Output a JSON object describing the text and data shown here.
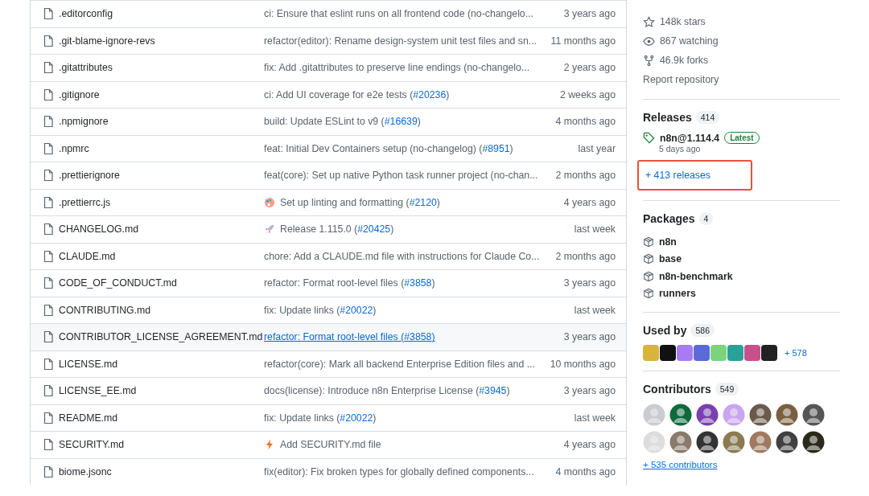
{
  "files": [
    {
      "name": ".editorconfig",
      "message": "ci: Ensure that eslint runs on all frontend code (no-changelo...",
      "time": "3 years ago",
      "hovered": false
    },
    {
      "name": ".git-blame-ignore-revs",
      "message": "refactor(editor): Rename design-system unit test files and sn...",
      "time": "11 months ago",
      "hovered": false
    },
    {
      "name": ".gitattributes",
      "message": "fix: Add .gitattributes to preserve line endings (no-changelo...",
      "time": "2 years ago",
      "hovered": false
    },
    {
      "name": ".gitignore",
      "message": "ci: Add UI coverage for e2e tests (",
      "pr": "#20236",
      "after": ")",
      "time": "2 weeks ago",
      "hovered": false
    },
    {
      "name": ".npmignore",
      "message": "build: Update ESLint to v9 (",
      "pr": "#16639",
      "after": ")",
      "time": "4 months ago",
      "hovered": false
    },
    {
      "name": ".npmrc",
      "message": "feat: Initial Dev Containers setup (no-changelog) (",
      "pr": "#8951",
      "after": ")",
      "time": "last year",
      "hovered": false
    },
    {
      "name": ".prettierignore",
      "message": "feat(core): Set up native Python task runner project (no-chan...",
      "time": "2 months ago",
      "hovered": false
    },
    {
      "name": ".prettierrc.js",
      "kind": "palette",
      "message": "Set up linting and formatting (",
      "pr": "#2120",
      "after": ")",
      "time": "4 years ago",
      "hovered": false
    },
    {
      "name": "CHANGELOG.md",
      "kind": "rocket",
      "message": "Release 1.115.0 (",
      "pr": "#20425",
      "after": ")",
      "time": "last week",
      "hovered": false
    },
    {
      "name": "CLAUDE.md",
      "message": "chore: Add a CLAUDE.md file with instructions for Claude Co...",
      "time": "2 months ago",
      "hovered": false
    },
    {
      "name": "CODE_OF_CONDUCT.md",
      "message": "refactor: Format root-level files (",
      "pr": "#3858",
      "after": ")",
      "time": "3 years ago",
      "hovered": false
    },
    {
      "name": "CONTRIBUTING.md",
      "message": "fix: Update links (",
      "pr": "#20022",
      "after": ")",
      "time": "last week",
      "hovered": false
    },
    {
      "name": "CONTRIBUTOR_LICENSE_AGREEMENT.md",
      "message": "refactor: Format root-level files (",
      "pr": "#3858",
      "after": ")",
      "time": "3 years ago",
      "hovered": true
    },
    {
      "name": "LICENSE.md",
      "message": "refactor(core): Mark all backend Enterprise Edition files and ...",
      "time": "10 months ago",
      "hovered": false
    },
    {
      "name": "LICENSE_EE.md",
      "message": "docs(license): Introduce n8n Enterprise License (",
      "pr": "#3945",
      "after": ")",
      "time": "3 years ago",
      "hovered": false
    },
    {
      "name": "README.md",
      "message": "fix: Update links (",
      "pr": "#20022",
      "after": ")",
      "time": "last week",
      "hovered": false
    },
    {
      "name": "SECURITY.md",
      "kind": "zap",
      "message": "Add SECURITY.md file",
      "time": "4 years ago",
      "hovered": false
    },
    {
      "name": "biome.jsonc",
      "message": "fix(editor): Fix broken types for globally defined components...",
      "time": "4 months ago",
      "hovered": false
    }
  ],
  "stats": [
    {
      "kind": "star",
      "text": "148k stars"
    },
    {
      "kind": "eye",
      "text": "867 watching"
    },
    {
      "kind": "fork",
      "text": "46.9k forks"
    }
  ],
  "report": "Report repository",
  "releases": {
    "title": "Releases",
    "count": "414",
    "latest": {
      "name": "n8n@1.114.4",
      "badge": "Latest",
      "date": "5 days ago"
    },
    "more": "+ 413 releases",
    "highlighted": true
  },
  "packages": {
    "title": "Packages",
    "count": "4",
    "items": [
      "n8n",
      "base",
      "n8n-benchmark",
      "runners"
    ]
  },
  "used_by": {
    "title": "Used by",
    "count": "586",
    "avatars": [
      {
        "color": "#d8b43c"
      },
      {
        "color": "#111111"
      },
      {
        "color": "#a77cf0"
      },
      {
        "color": "#5a6bd8"
      },
      {
        "color": "#7bd47a"
      },
      {
        "color": "#2aa198"
      },
      {
        "color": "#c94f8a"
      },
      {
        "color": "#222222"
      }
    ],
    "more": "+ 578"
  },
  "contributors": {
    "title": "Contributors",
    "count": "549",
    "avatars": [
      {
        "color": "#c9ccd1"
      },
      {
        "color": "#0d6b3a"
      },
      {
        "color": "#7a3fb0"
      },
      {
        "color": "#c9a4f0"
      },
      {
        "color": "#6b5a4a"
      },
      {
        "color": "#7a6040"
      },
      {
        "color": "#555555"
      },
      {
        "color": "#dddddd"
      },
      {
        "color": "#8a7a6a"
      },
      {
        "color": "#333333"
      },
      {
        "color": "#8a7a50"
      },
      {
        "color": "#a07a60"
      },
      {
        "color": "#404040"
      },
      {
        "color": "#2a2a1a"
      }
    ],
    "more": "+ 535 contributors"
  }
}
